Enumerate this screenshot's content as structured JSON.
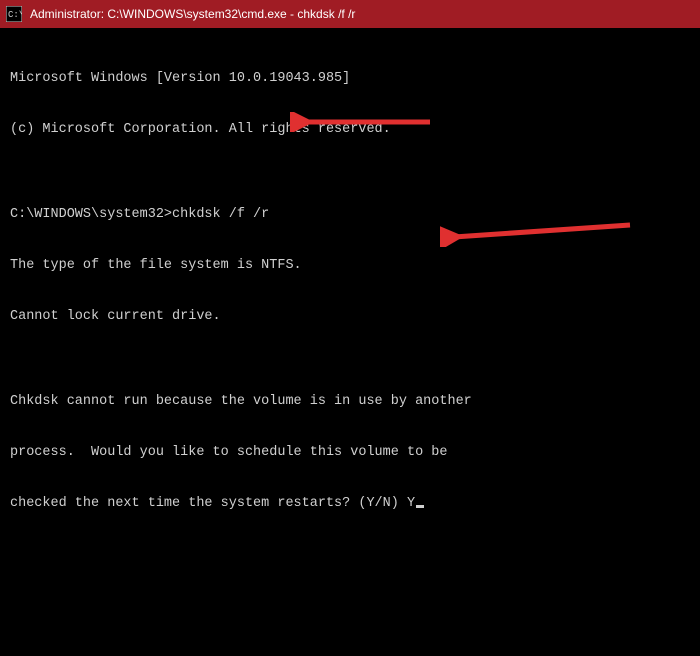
{
  "titlebar": {
    "title": "Administrator: C:\\WINDOWS\\system32\\cmd.exe - chkdsk  /f /r"
  },
  "terminal": {
    "line1": "Microsoft Windows [Version 10.0.19043.985]",
    "line2": "(c) Microsoft Corporation. All rights reserved.",
    "blank1": "",
    "prompt": "C:\\WINDOWS\\system32>",
    "command": "chkdsk /f /r",
    "line3": "The type of the file system is NTFS.",
    "line4": "Cannot lock current drive.",
    "blank2": "",
    "line5": "Chkdsk cannot run because the volume is in use by another",
    "line6": "process.  Would you like to schedule this volume to be",
    "line7": "checked the next time the system restarts? (Y/N) ",
    "user_input": "Y"
  }
}
